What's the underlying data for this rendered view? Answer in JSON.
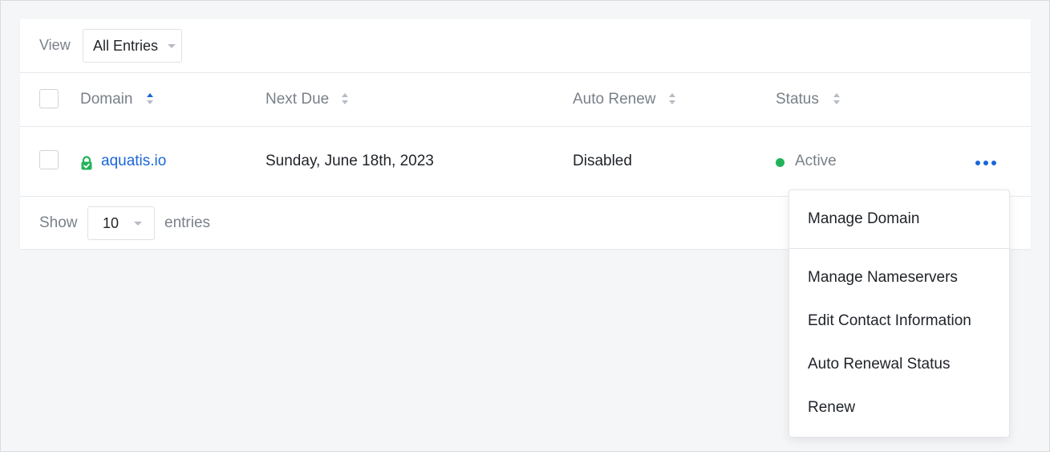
{
  "view": {
    "label": "View",
    "selected": "All Entries"
  },
  "table": {
    "columns": [
      {
        "label": "Domain",
        "sort_active": true
      },
      {
        "label": "Next Due",
        "sort_active": false
      },
      {
        "label": "Auto Renew",
        "sort_active": false
      },
      {
        "label": "Status",
        "sort_active": false
      }
    ],
    "rows": [
      {
        "domain": "aquatis.io",
        "domain_secure": true,
        "next_due": "Sunday, June 18th, 2023",
        "auto_renew": "Disabled",
        "status": "Active"
      }
    ]
  },
  "footer": {
    "show_label": "Show",
    "page_size": "10",
    "entries_label": "entries"
  },
  "menu": {
    "items": [
      "Manage Domain",
      "Manage Nameservers",
      "Edit Contact Information",
      "Auto Renewal Status",
      "Renew"
    ]
  },
  "colors": {
    "accent": "#1a66d9",
    "status_active": "#22b35a",
    "muted_text": "#7a8088"
  },
  "icons": {
    "lock": "lock-icon",
    "sort": "sort-icon",
    "more": "more-icon",
    "caret": "chevron-down-icon"
  }
}
